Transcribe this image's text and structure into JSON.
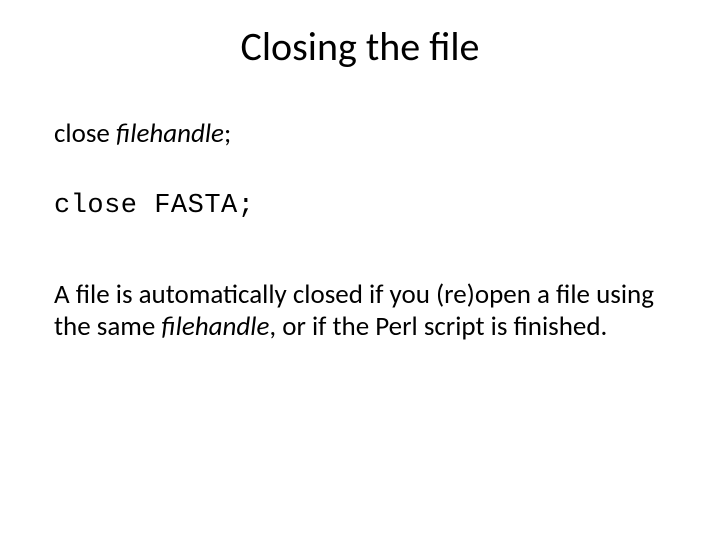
{
  "title": "Closing the file",
  "syntax": {
    "close_word": "close ",
    "filehandle_word": "filehandle",
    "semicolon": ";"
  },
  "example": "close FASTA;",
  "paragraph": {
    "p1": "A file is automatically closed if you (re)open a file using the same ",
    "p2": "filehandle",
    "p3": ", or if the Perl script is finished."
  }
}
